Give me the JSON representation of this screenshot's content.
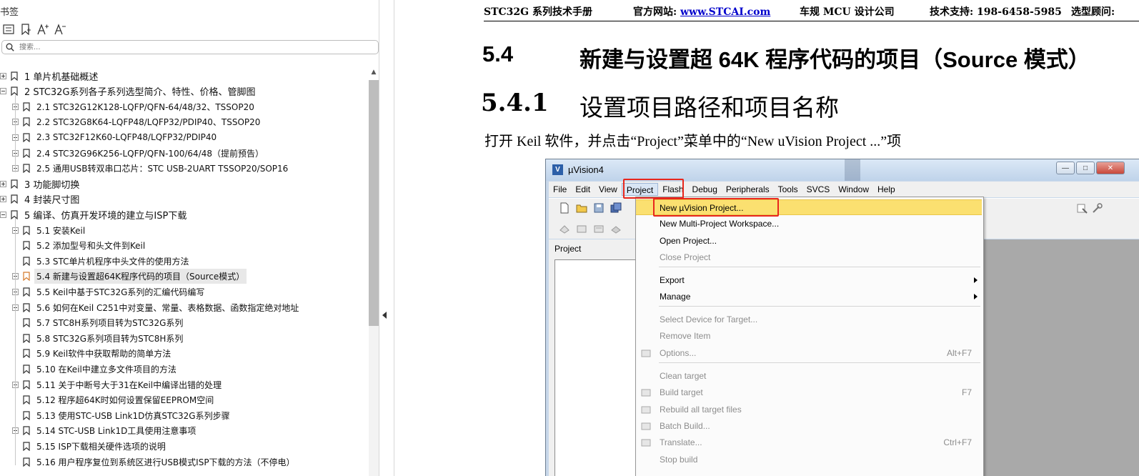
{
  "sidebar": {
    "title": "书签",
    "search_placeholder": "搜索...",
    "items": [
      {
        "label": "1 单片机基础概述",
        "level": 1,
        "expander": "plus"
      },
      {
        "label": "2  STC32G系列各子系列选型简介、特性、价格、管脚图",
        "level": 1,
        "expander": "minus"
      },
      {
        "label": "2.1  STC32G12K128-LQFP/QFN-64/48/32、TSSOP20",
        "level": 2,
        "expander": "plus"
      },
      {
        "label": "2.2   STC32G8K64-LQFP48/LQFP32/PDIP40、TSSOP20",
        "level": 2,
        "expander": "plus"
      },
      {
        "label": "2.3   STC32F12K60-LQFP48/LQFP32/PDIP40",
        "level": 2,
        "expander": "plus"
      },
      {
        "label": "2.4   STC32G96K256-LQFP/QFN-100/64/48（提前预告）",
        "level": 2,
        "expander": "plus"
      },
      {
        "label": "2.5   通用USB转双串口芯片：STC USB-2UART TSSOP20/SOP16",
        "level": 2,
        "expander": "plus"
      },
      {
        "label": "3  功能脚切换",
        "level": 1,
        "expander": "plus"
      },
      {
        "label": "4  封装尺寸图",
        "level": 1,
        "expander": "plus"
      },
      {
        "label": "5  编译、仿真开发环境的建立与ISP下载",
        "level": 1,
        "expander": "minus"
      },
      {
        "label": "5.1  安装Keil",
        "level": 2,
        "expander": "plus"
      },
      {
        "label": "5.2  添加型号和头文件到Keil",
        "level": 2,
        "expander": "none"
      },
      {
        "label": "5.3  STC单片机程序中头文件的使用方法",
        "level": 2,
        "expander": "none"
      },
      {
        "label": "5.4  新建与设置超64K程序代码的项目（Source模式）",
        "level": 2,
        "expander": "plus",
        "selected": true
      },
      {
        "label": "5.5  Keil中基于STC32G系列的汇编代码编写",
        "level": 2,
        "expander": "plus"
      },
      {
        "label": "5.6  如何在Keil C251中对变量、常量、表格数据、函数指定绝对地址",
        "level": 2,
        "expander": "plus"
      },
      {
        "label": "5.7  STC8H系列项目转为STC32G系列",
        "level": 2,
        "expander": "none"
      },
      {
        "label": "5.8  STC32G系列项目转为STC8H系列",
        "level": 2,
        "expander": "none"
      },
      {
        "label": "5.9  Keil软件中获取帮助的简单方法",
        "level": 2,
        "expander": "none"
      },
      {
        "label": "5.10  在Keil中建立多文件项目的方法",
        "level": 2,
        "expander": "none"
      },
      {
        "label": "5.11  关于中断号大于31在Keil中编译出错的处理",
        "level": 2,
        "expander": "plus"
      },
      {
        "label": "5.12  程序超64K时如何设置保留EEPROM空间",
        "level": 2,
        "expander": "none"
      },
      {
        "label": "5.13  使用STC-USB Link1D仿真STC32G系列步骤",
        "level": 2,
        "expander": "none"
      },
      {
        "label": "5.14  STC-USB Link1D工具使用注意事项",
        "level": 2,
        "expander": "plus"
      },
      {
        "label": "5.15  ISP下载相关硬件选项的说明",
        "level": 2,
        "expander": "none"
      },
      {
        "label": "5.16  用户程序复位到系统区进行USB模式ISP下载的方法（不停电）",
        "level": 2,
        "expander": "none"
      }
    ]
  },
  "doc": {
    "header": {
      "manual": "STC32G 系列技术手册",
      "website_label": "官方网站:",
      "website_url": "www.STCAI.com",
      "company": "车规 MCU 设计公司",
      "support": "技术支持: 198-6458-5985",
      "consult": "选型顾问:"
    },
    "h1_num": "5.4",
    "h1_text": "新建与设置超 64K 程序代码的项目（Source 模式）",
    "h2_num": "5.4.1",
    "h2_text": "设置项目路径和项目名称",
    "paragraph": "打开 Keil 软件，并点击“Project”菜单中的“New uVision Project ...”项"
  },
  "uvision": {
    "title": "µVision4",
    "menus": [
      "File",
      "Edit",
      "View",
      "Project",
      "Flash",
      "Debug",
      "Peripherals",
      "Tools",
      "SVCS",
      "Window",
      "Help"
    ],
    "active_menu": "Project",
    "project_pane_title": "Project",
    "project_menu": [
      {
        "label": "New µVision Project...",
        "highlight": true
      },
      {
        "label": "New Multi-Project Workspace..."
      },
      {
        "label": "Open Project..."
      },
      {
        "label": "Close Project",
        "disabled": true
      },
      {
        "label": "Export",
        "submenu": true
      },
      {
        "label": "Manage",
        "submenu": true
      },
      {
        "label": "Select Device for Target...",
        "disabled": true
      },
      {
        "label": "Remove Item",
        "disabled": true
      },
      {
        "label": "Options...",
        "shortcut": "Alt+F7",
        "disabled": true
      },
      {
        "label": "Clean target",
        "disabled": true
      },
      {
        "label": "Build target",
        "shortcut": "F7",
        "disabled": true
      },
      {
        "label": "Rebuild all target files",
        "disabled": true
      },
      {
        "label": "Batch Build...",
        "disabled": true
      },
      {
        "label": "Translate...",
        "shortcut": "Ctrl+F7",
        "disabled": true
      },
      {
        "label": "Stop build",
        "disabled": true
      }
    ]
  },
  "colors": {
    "highlight_box": "#e8261c",
    "menu_highlight": "#fbe070",
    "link": "#0000cc"
  }
}
